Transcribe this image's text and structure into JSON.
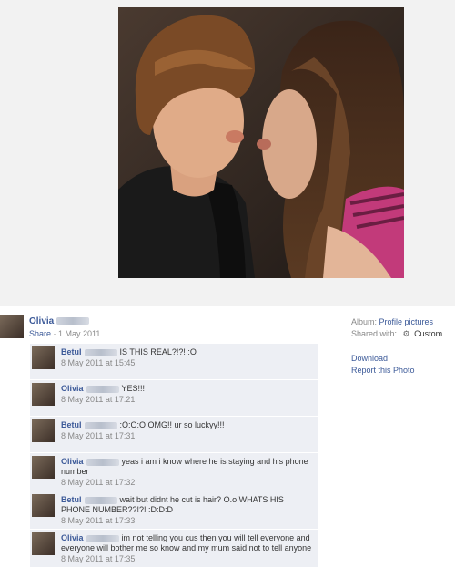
{
  "post": {
    "poster_name": "Olivia",
    "share_label": "Share",
    "share_separator": " · ",
    "post_date": "1 May 2011"
  },
  "comments": [
    {
      "name": "Betul",
      "text": "IS THIS REAL?!?! :O",
      "time": "8 May 2011 at 15:45"
    },
    {
      "name": "Olivia",
      "text": "YES!!!",
      "time": "8 May 2011 at 17:21"
    },
    {
      "name": "Betul",
      "text": ":O:O:O OMG!! ur so luckyy!!!",
      "time": "8 May 2011 at 17:31"
    },
    {
      "name": "Olivia",
      "text": "yeas i am i know where he is staying and his phone number",
      "time": "8 May 2011 at 17:32"
    },
    {
      "name": "Betul",
      "text": "wait but didnt he cut is hair? O.o WHATS HIS PHONE NUMBER??!?! :D:D:D",
      "time": "8 May 2011 at 17:33"
    },
    {
      "name": "Olivia",
      "text": "im not telling you cus then you will tell everyone and everyone will bother me so know and my mum said not to tell anyone",
      "time": "8 May 2011 at 17:35"
    }
  ],
  "sidebar": {
    "album_label": "Album:",
    "album_value": "Profile pictures",
    "shared_label": "Shared with:",
    "shared_value": "Custom",
    "shared_icon": "gear-icon",
    "download_label": "Download",
    "report_label": "Report this Photo"
  },
  "colors": {
    "link": "#3b5998",
    "comment_bg": "#edeff4",
    "muted": "#888888"
  }
}
